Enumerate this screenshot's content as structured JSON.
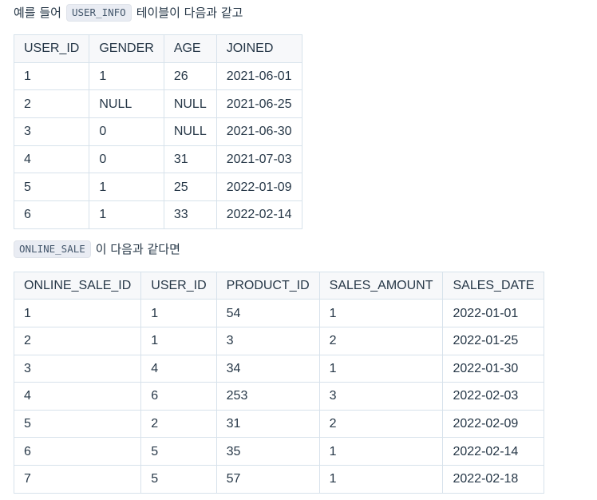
{
  "intro1": {
    "text_before": "예를 들어",
    "code": "USER_INFO",
    "text_after": "테이블이 다음과 같고"
  },
  "user_info": {
    "headers": [
      "USER_ID",
      "GENDER",
      "AGE",
      "JOINED"
    ],
    "rows": [
      [
        "1",
        "1",
        "26",
        "2021-06-01"
      ],
      [
        "2",
        "NULL",
        "NULL",
        "2021-06-25"
      ],
      [
        "3",
        "0",
        "NULL",
        "2021-06-30"
      ],
      [
        "4",
        "0",
        "31",
        "2021-07-03"
      ],
      [
        "5",
        "1",
        "25",
        "2022-01-09"
      ],
      [
        "6",
        "1",
        "33",
        "2022-02-14"
      ]
    ]
  },
  "intro2": {
    "code": "ONLINE_SALE",
    "text_after": "이 다음과 같다면"
  },
  "online_sale": {
    "headers": [
      "ONLINE_SALE_ID",
      "USER_ID",
      "PRODUCT_ID",
      "SALES_AMOUNT",
      "SALES_DATE"
    ],
    "rows": [
      [
        "1",
        "1",
        "54",
        "1",
        "2022-01-01"
      ],
      [
        "2",
        "1",
        "3",
        "2",
        "2022-01-25"
      ],
      [
        "3",
        "4",
        "34",
        "1",
        "2022-01-30"
      ],
      [
        "4",
        "6",
        "253",
        "3",
        "2022-02-03"
      ],
      [
        "5",
        "2",
        "31",
        "2",
        "2022-02-09"
      ],
      [
        "6",
        "5",
        "35",
        "1",
        "2022-02-14"
      ],
      [
        "7",
        "5",
        "57",
        "1",
        "2022-02-18"
      ]
    ]
  }
}
